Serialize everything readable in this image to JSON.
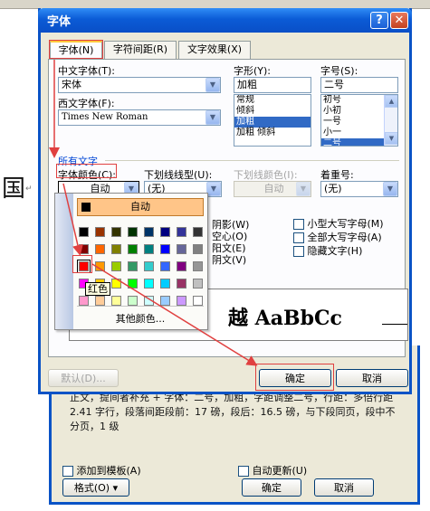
{
  "document": {
    "visible_char": "国",
    "para_mark": "↵"
  },
  "back_dialog": {
    "description": "正文，提间者补充 + 字体：二号，加粗，字距调整二号，行距：多倍行距 2.41 字行，段落间距段前：17 磅，段后：16.5 磅，与下段同页，段中不分页，1 级",
    "add_to_template": "添加到模板(A)",
    "auto_update": "自动更新(U)",
    "format_button": "格式(O) ▾",
    "ok": "确定",
    "cancel": "取消"
  },
  "dialog": {
    "title": "字体",
    "help": "?",
    "close": "✕",
    "tabs": [
      "字体(N)",
      "字符间距(R)",
      "文字效果(X)"
    ],
    "chinese_font_label": "中文字体(T):",
    "chinese_font_value": "宋体",
    "western_font_label": "西文字体(F):",
    "western_font_value": "Times New Roman",
    "style_label": "字形(Y):",
    "style_value": "加粗",
    "style_options": [
      "常规",
      "倾斜",
      "加粗",
      "加粗 倾斜"
    ],
    "style_selected": 2,
    "size_label": "字号(S):",
    "size_value": "二号",
    "size_options": [
      "初号",
      "小初",
      "一号",
      "小一",
      "二号"
    ],
    "size_selected": 4,
    "all_text": "所有文字",
    "font_color_label": "字体颜色(C):",
    "font_color_value": "自动",
    "underline_style_label": "下划线线型(U):",
    "underline_style_value": "(无)",
    "underline_color_label": "下划线颜色(I):",
    "underline_color_value": "自动",
    "emphasis_label": "着重号:",
    "emphasis_value": "(无)",
    "effects_partial": [
      "阴影(W)",
      "空心(O)",
      "阳文(E)",
      "阴文(V)"
    ],
    "effects_right": [
      "小型大写字母(M)",
      "全部大写字母(A)",
      "隐藏文字(H)"
    ],
    "preview_text": "越 AaBbCc",
    "default_button": "默认(D)...",
    "ok": "确定",
    "cancel": "取消"
  },
  "color_popup": {
    "auto_label": "自动",
    "more_colors": "其他颜色...",
    "tooltip": "红色",
    "swatches": [
      [
        "#000000",
        "#993300",
        "#333300",
        "#003300",
        "#003366",
        "#000080",
        "#333399",
        "#333333"
      ],
      [
        "#800000",
        "#FF6600",
        "#808000",
        "#008000",
        "#008080",
        "#0000FF",
        "#666699",
        "#808080"
      ],
      [
        "#FF0000",
        "#FF9900",
        "#99CC00",
        "#339966",
        "#33CCCC",
        "#3366FF",
        "#800080",
        "#969696"
      ],
      [
        "#FF00FF",
        "#FFCC00",
        "#FFFF00",
        "#00FF00",
        "#00FFFF",
        "#00CCFF",
        "#993366",
        "#C0C0C0"
      ],
      [
        "#FF99CC",
        "#FFCC99",
        "#FFFF99",
        "#CCFFCC",
        "#CCFFFF",
        "#99CCFF",
        "#CC99FF",
        "#FFFFFF"
      ]
    ],
    "highlighted": [
      2,
      0
    ]
  },
  "colors": {
    "annotation": "#e04040",
    "selection": "#316ac5",
    "titlebar": "#0b5bd6"
  }
}
